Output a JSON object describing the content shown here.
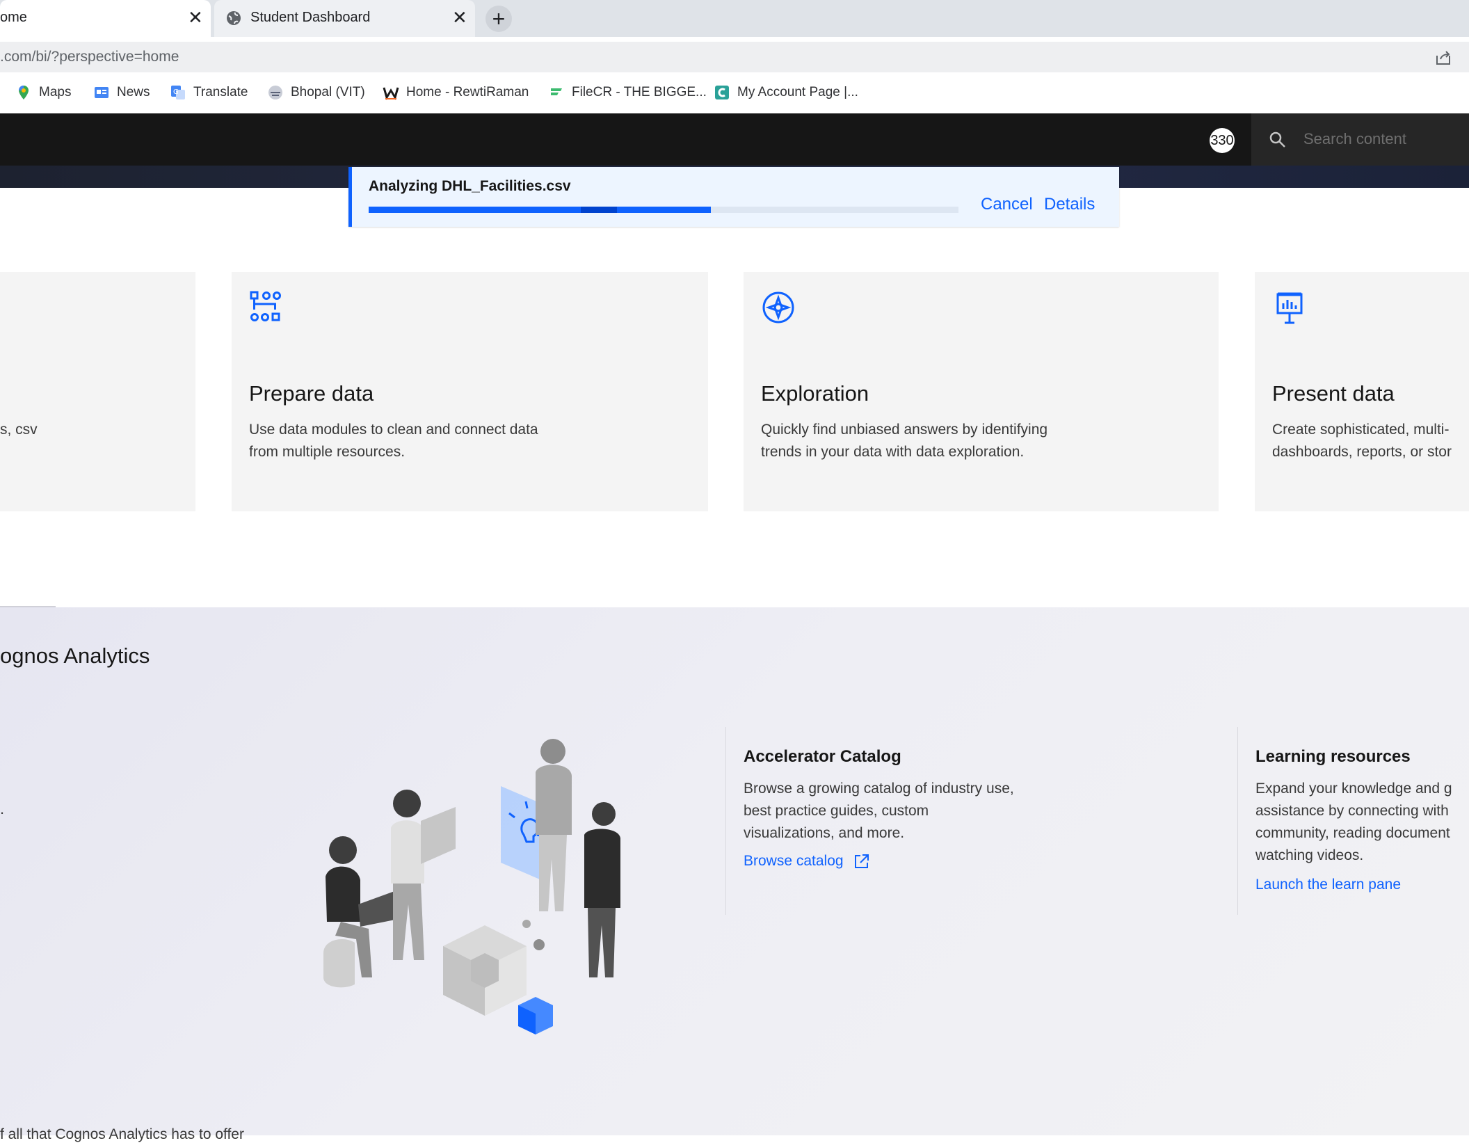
{
  "browser": {
    "tabs": [
      {
        "label": "ome",
        "active": true
      },
      {
        "label": "Student Dashboard",
        "active": false
      }
    ],
    "new_tab_symbol": "+",
    "url": ".com/bi/?perspective=home",
    "bookmarks": [
      {
        "label": "Maps",
        "icon": "maps-pin-icon"
      },
      {
        "label": "News",
        "icon": "google-news-icon"
      },
      {
        "label": "Translate",
        "icon": "translate-icon"
      },
      {
        "label": "Bhopal (VIT)",
        "icon": "vit-logo-icon"
      },
      {
        "label": "Home - RewtiRaman",
        "icon": "w-logo-icon"
      },
      {
        "label": "FileCR - THE BIGGE...",
        "icon": "filecr-icon"
      },
      {
        "label": "My Account Page |...",
        "icon": "coursera-icon"
      }
    ]
  },
  "header": {
    "avatar_text": "330",
    "search_placeholder": "Search content"
  },
  "toast": {
    "title": "Analyzing DHL_Facilities.csv",
    "progress_fraction": 0.58,
    "cancel_label": "Cancel",
    "details_label": "Details",
    "accent_color": "#0f62fe"
  },
  "cards": [
    {
      "title": "",
      "desc_lines": [
        "s, csv"
      ],
      "icon": ""
    },
    {
      "title": "Prepare data",
      "desc_lines": [
        "Use data modules to clean and connect data",
        "from multiple resources."
      ],
      "icon": "data-module-icon"
    },
    {
      "title": "Exploration",
      "desc_lines": [
        "Quickly find unbiased answers by identifying",
        "trends in your data with data exploration."
      ],
      "icon": "compass-icon"
    },
    {
      "title": "Present data",
      "desc_lines": [
        "Create sophisticated, multi-",
        "dashboards, reports, or stor"
      ],
      "icon": "presentation-icon"
    }
  ],
  "lower": {
    "title": "ognos Analytics",
    "stray_text": ".",
    "resources": [
      {
        "title": "Accelerator Catalog",
        "desc_lines": [
          "Browse a growing catalog of industry use,",
          "best practice guides, custom",
          "visualizations, and more."
        ],
        "link": "Browse catalog"
      },
      {
        "title": "Learning resources",
        "desc_lines": [
          "Expand your knowledge and g",
          "assistance by connecting with",
          "community, reading document",
          "watching videos."
        ],
        "link": "Launch the learn pane"
      }
    ],
    "bottom_text": "f all that Cognos Analytics has to offer"
  }
}
